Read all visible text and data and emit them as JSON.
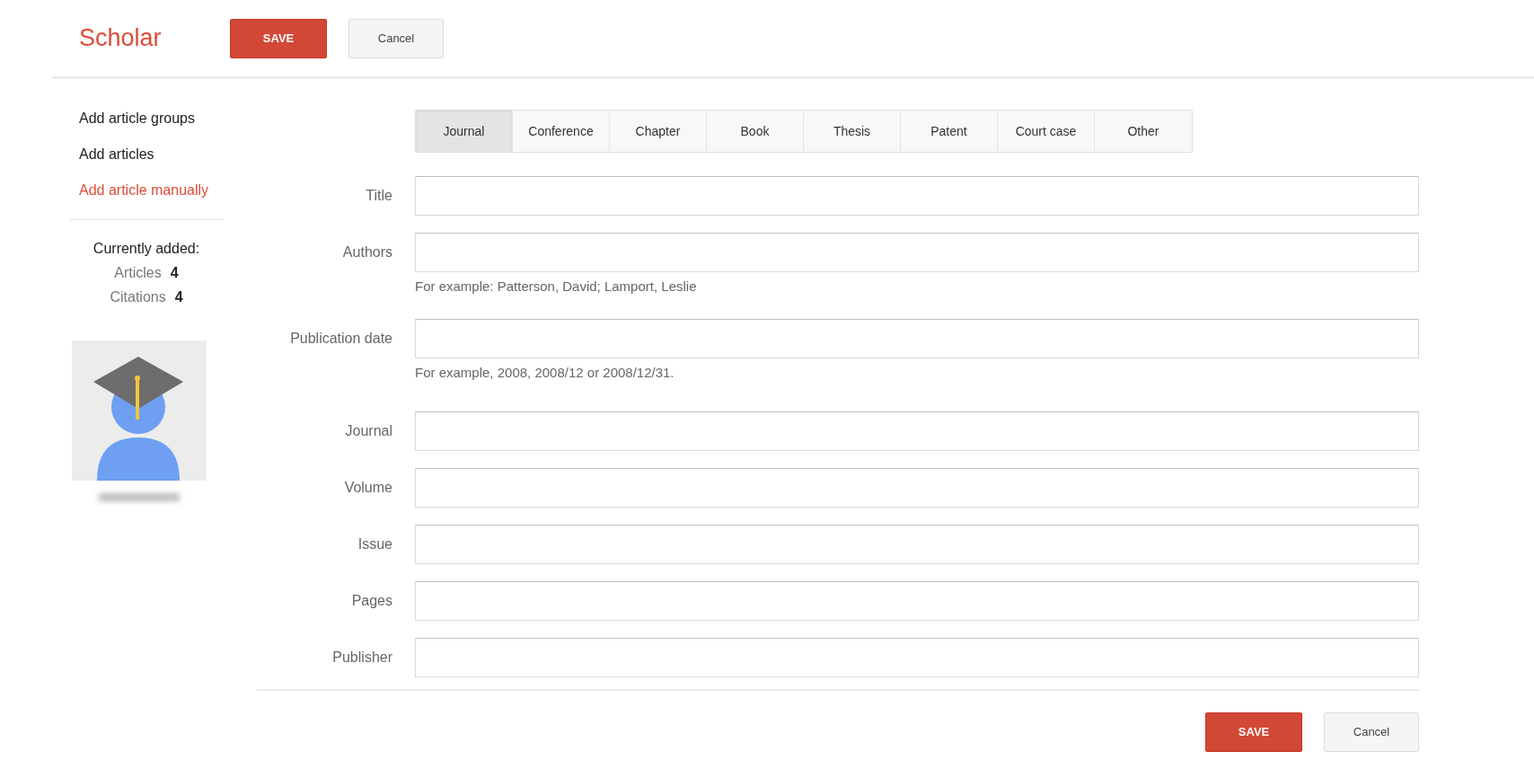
{
  "app": {
    "logo": "Scholar"
  },
  "header_buttons": [
    {
      "label": "SAVE",
      "kind": "primary"
    },
    {
      "label": "Cancel",
      "kind": "secondary"
    }
  ],
  "sidebar": {
    "items": [
      {
        "label": "Add article groups",
        "selected": false
      },
      {
        "label": "Add articles",
        "selected": false
      },
      {
        "label": "Add article manually",
        "selected": true
      }
    ],
    "summary": {
      "heading": "Currently added:",
      "stats": [
        {
          "label": "Articles",
          "value": "4"
        },
        {
          "label": "Citations",
          "value": "4"
        }
      ]
    }
  },
  "tabs": [
    {
      "label": "Journal",
      "selected": true
    },
    {
      "label": "Conference",
      "selected": false
    },
    {
      "label": "Chapter",
      "selected": false
    },
    {
      "label": "Book",
      "selected": false
    },
    {
      "label": "Thesis",
      "selected": false
    },
    {
      "label": "Patent",
      "selected": false
    },
    {
      "label": "Court case",
      "selected": false
    },
    {
      "label": "Other",
      "selected": false
    }
  ],
  "field_groups": [
    [
      {
        "label": "Title"
      },
      {
        "label": "Authors",
        "hint": "For example: Patterson, David; Lamport, Leslie"
      },
      {
        "label": "Publication date",
        "hint": "For example, 2008, 2008/12 or 2008/12/31."
      }
    ],
    [
      {
        "label": "Journal"
      },
      {
        "label": "Volume"
      },
      {
        "label": "Issue"
      },
      {
        "label": "Pages"
      },
      {
        "label": "Publisher"
      }
    ]
  ],
  "footer_buttons": [
    {
      "label": "SAVE",
      "kind": "primary"
    },
    {
      "label": "Cancel",
      "kind": "secondary"
    }
  ]
}
